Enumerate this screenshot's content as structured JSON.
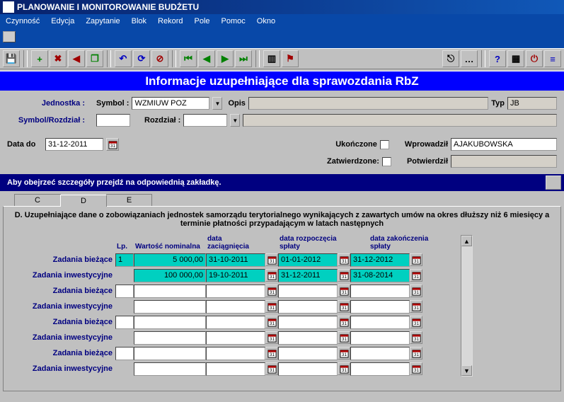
{
  "window": {
    "title": "PLANOWANIE I MONITOROWANIE BUDŻETU"
  },
  "menu": {
    "czynnosc": "Czynność",
    "edycja": "Edycja",
    "zapytanie": "Zapytanie",
    "blok": "Blok",
    "rekord": "Rekord",
    "pole": "Pole",
    "pomoc": "Pomoc",
    "okno": "Okno"
  },
  "header": {
    "title": "Informacje uzupełniające dla sprawozdania RbZ"
  },
  "form": {
    "jednostka_label": "Jednostka :",
    "symbol_label": "Symbol :",
    "symbol_value": "WZMIUW POZ",
    "opis_label": "Opis",
    "opis_value": "",
    "typ_label": "Typ",
    "typ_value": "JB",
    "symbolrozdzial_label": "Symbol/Rozdział :",
    "symbolrozdzial_value": "",
    "rozdzial_label": "Rozdział :",
    "rozdzial_value": "",
    "rozdzial_opis_value": "",
    "data_do_label": "Data do",
    "data_do_value": "31-12-2011",
    "ukonczone_label": "Ukończone",
    "zatwierdzone_label": "Zatwierdzone:",
    "wprowadzil_label": "Wprowadził",
    "wprowadzil_value": "AJAKUBOWSKA",
    "potwierdzil_label": "Potwierdził",
    "potwierdzil_value": ""
  },
  "note": "Aby obejrzeć szczegóły przejdź na odpowiednią zakładkę.",
  "tabs": {
    "c": "C",
    "d": "D",
    "e": "E"
  },
  "section": {
    "text": "D. Uzupełniające dane o zobowiązaniach jednostek samorządu terytorialnego wynikających z zawartych umów na okres dłuższy niż 6 miesięcy a terminie płatności przypadającym w latach następnych"
  },
  "grid": {
    "head": {
      "lp": "Lp.",
      "wartosc": "Wartość nominalna",
      "data_zac": "data zaciągnięcia",
      "data_roz": "data rozpoczęcia spłaty",
      "data_zak": "data zakończenia spłaty"
    },
    "row_labels": {
      "biezace": "Zadania bieżące",
      "inwest": "Zadania inwestycyjne"
    },
    "rows": [
      {
        "label_key": "biezace",
        "hl": true,
        "lp": "1",
        "wartosc": "5 000,00",
        "d1": "31-10-2011",
        "d2": "01-01-2012",
        "d3": "31-12-2012"
      },
      {
        "label_key": "inwest",
        "hl": true,
        "lp": "",
        "wartosc": "100 000,00",
        "d1": "19-10-2011",
        "d2": "31-12-2011",
        "d3": "31-08-2014"
      },
      {
        "label_key": "biezace",
        "hl": false,
        "lp": "",
        "wartosc": "",
        "d1": "",
        "d2": "",
        "d3": ""
      },
      {
        "label_key": "inwest",
        "hl": false,
        "lp": "",
        "wartosc": "",
        "d1": "",
        "d2": "",
        "d3": ""
      },
      {
        "label_key": "biezace",
        "hl": false,
        "lp": "",
        "wartosc": "",
        "d1": "",
        "d2": "",
        "d3": ""
      },
      {
        "label_key": "inwest",
        "hl": false,
        "lp": "",
        "wartosc": "",
        "d1": "",
        "d2": "",
        "d3": ""
      },
      {
        "label_key": "biezace",
        "hl": false,
        "lp": "",
        "wartosc": "",
        "d1": "",
        "d2": "",
        "d3": ""
      },
      {
        "label_key": "inwest",
        "hl": false,
        "lp": "",
        "wartosc": "",
        "d1": "",
        "d2": "",
        "d3": ""
      }
    ]
  }
}
